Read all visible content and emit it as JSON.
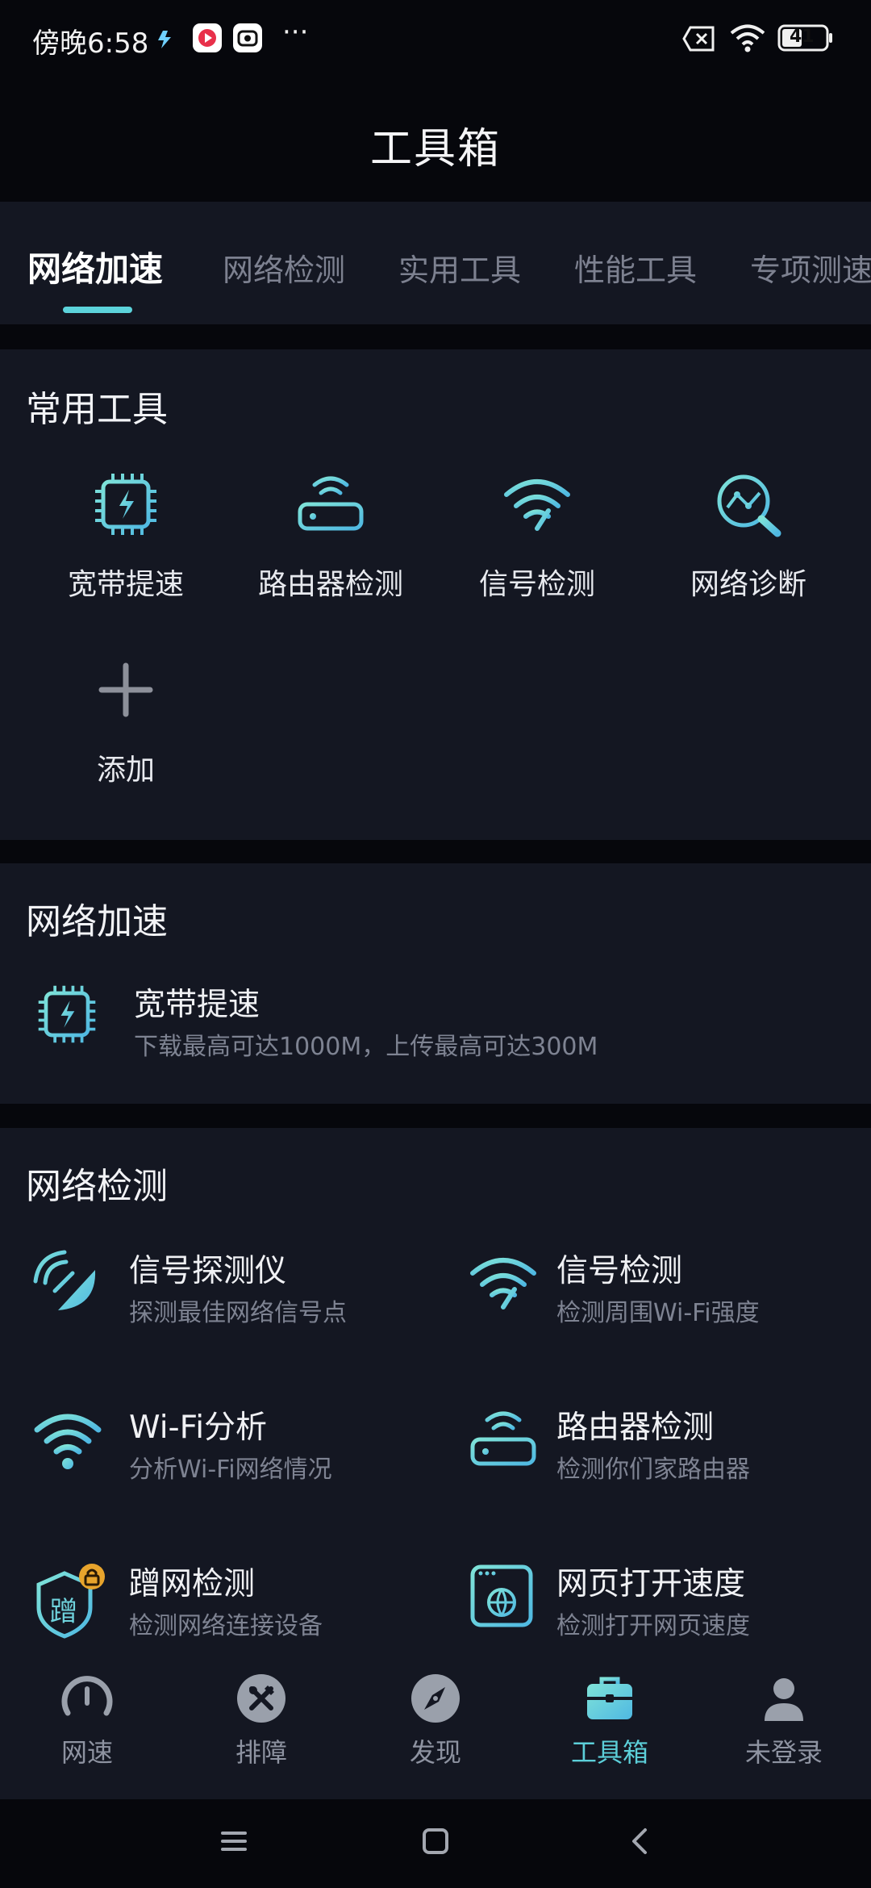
{
  "status_bar": {
    "time": "傍晚6:58",
    "more": "···",
    "battery": "41"
  },
  "header": {
    "title": "工具箱"
  },
  "tabs": [
    {
      "label": "网络加速",
      "active": true
    },
    {
      "label": "网络检测",
      "active": false
    },
    {
      "label": "实用工具",
      "active": false
    },
    {
      "label": "性能工具",
      "active": false
    },
    {
      "label": "专项测速",
      "active": false
    }
  ],
  "common_tools": {
    "title": "常用工具",
    "items": [
      {
        "label": "宽带提速",
        "icon": "chip-bolt-icon"
      },
      {
        "label": "路由器检测",
        "icon": "router-icon"
      },
      {
        "label": "信号检测",
        "icon": "wifi-signal-icon"
      },
      {
        "label": "网络诊断",
        "icon": "network-diagnose-icon"
      },
      {
        "label": "添加",
        "icon": "plus-icon"
      }
    ]
  },
  "acceleration": {
    "title": "网络加速",
    "items": [
      {
        "title": "宽带提速",
        "subtitle": "下载最高可达1000M，上传最高可达300M",
        "icon": "chip-bolt-icon"
      }
    ]
  },
  "detection": {
    "title": "网络检测",
    "items": [
      {
        "title": "信号探测仪",
        "subtitle": "探测最佳网络信号点",
        "icon": "signal-radar-icon"
      },
      {
        "title": "信号检测",
        "subtitle": "检测周围Wi-Fi强度",
        "icon": "wifi-signal-icon"
      },
      {
        "title": "Wi-Fi分析",
        "subtitle": "分析Wi-Fi网络情况",
        "icon": "wifi-icon"
      },
      {
        "title": "路由器检测",
        "subtitle": "检测你们家路由器",
        "icon": "router-icon"
      },
      {
        "title": "蹭网检测",
        "subtitle": "检测网络连接设备",
        "icon": "freeloader-shield-icon",
        "badge_char": "蹭"
      },
      {
        "title": "网页打开速度",
        "subtitle": "检测打开网页速度",
        "icon": "webpage-globe-icon"
      }
    ]
  },
  "bottom_nav": [
    {
      "label": "网速",
      "icon": "speedometer-icon",
      "active": false
    },
    {
      "label": "排障",
      "icon": "tools-icon",
      "active": false
    },
    {
      "label": "发现",
      "icon": "compass-icon",
      "active": false
    },
    {
      "label": "工具箱",
      "icon": "toolbox-icon",
      "active": true
    },
    {
      "label": "未登录",
      "icon": "user-icon",
      "active": false
    }
  ],
  "colors": {
    "accent": "#5cd3db",
    "background": "#06070c",
    "card": "#141722"
  }
}
